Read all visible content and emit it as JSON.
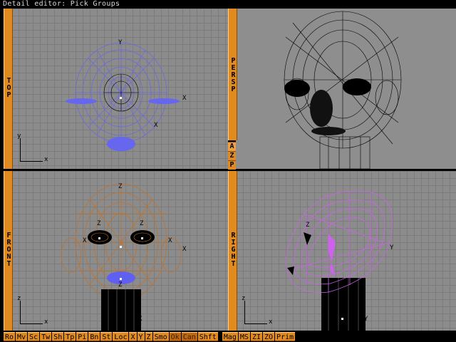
{
  "title": "Detail editor: Pick Groups",
  "viewports": {
    "top": {
      "label": "TOP",
      "axis_x": "x",
      "axis_y": "y"
    },
    "persp": {
      "label": "PERSP"
    },
    "front": {
      "label": "FRONT",
      "axis_x": "x",
      "axis_y": "z"
    },
    "right": {
      "label": "RIGHT",
      "axis_x": "x",
      "axis_y": "z"
    }
  },
  "persp_buttons": [
    "A",
    "Z",
    "P"
  ],
  "toolbar": {
    "buttons": [
      "Ro",
      "Mv",
      "Sc",
      "Tw",
      "Sh",
      "Tp",
      "Pi",
      "Bn",
      "St",
      "Loc",
      "X",
      "Y",
      "Z",
      "Smo",
      "Ok",
      "Can",
      "Shft",
      "Mag",
      "MS",
      "ZI",
      "ZO",
      "Prim"
    ]
  },
  "colors": {
    "accent": "#e08a20",
    "selected_blue": "#6060f0",
    "front_orange": "#c87020",
    "right_purple": "#d060f0"
  }
}
